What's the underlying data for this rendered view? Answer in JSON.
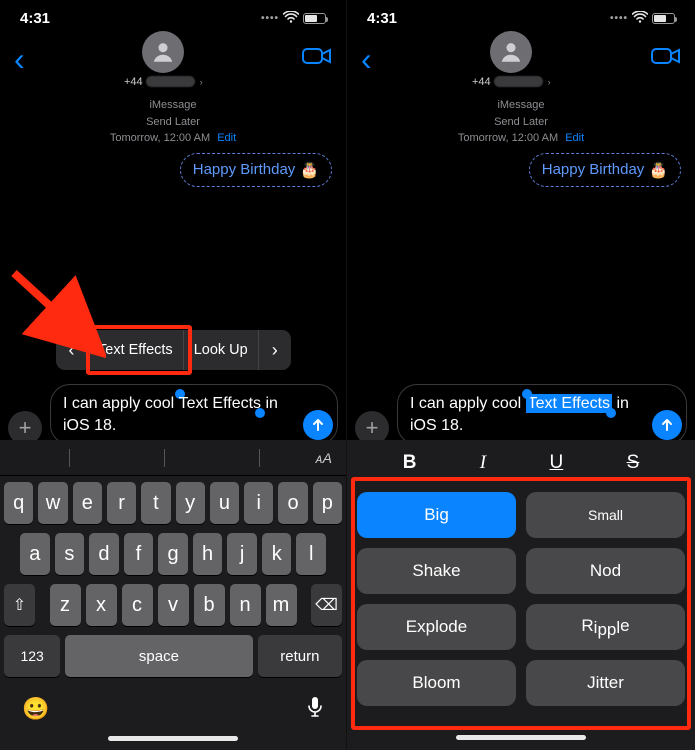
{
  "status": {
    "time": "4:31"
  },
  "contact": {
    "prefix": "+44"
  },
  "meta": {
    "service": "iMessage",
    "mode": "Send Later",
    "when_prefix": "Tomorrow,",
    "when_time": "12:00 AM",
    "edit": "Edit"
  },
  "bubble": {
    "text": "Happy Birthday",
    "emoji": "🎂"
  },
  "popover": {
    "prev": "‹",
    "text_effects": "Text Effects",
    "look_up": "Look Up",
    "next": "›"
  },
  "compose": {
    "pre": "I  can apply cool ",
    "sel": "Text Effects",
    "post": " in iOS 18."
  },
  "keyboard": {
    "row1": [
      "q",
      "w",
      "e",
      "r",
      "t",
      "y",
      "u",
      "i",
      "o",
      "p"
    ],
    "row2": [
      "a",
      "s",
      "d",
      "f",
      "g",
      "h",
      "j",
      "k",
      "l"
    ],
    "row3": [
      "z",
      "x",
      "c",
      "v",
      "b",
      "n",
      "m"
    ],
    "shift": "⇧",
    "del": "⌫",
    "num": "123",
    "space": "space",
    "ret": "return",
    "emoji": "😀",
    "mic": "🎤",
    "aA": "ᴀA"
  },
  "format": {
    "bold": "B",
    "italic": "I",
    "underline": "U",
    "strike": "S"
  },
  "effects": {
    "big": "Big",
    "small": "Small",
    "shake": "Shake",
    "nod": "Nod",
    "explode": "Explode",
    "ripple": "Ripple",
    "bloom": "Bloom",
    "jitter": "Jitter"
  }
}
